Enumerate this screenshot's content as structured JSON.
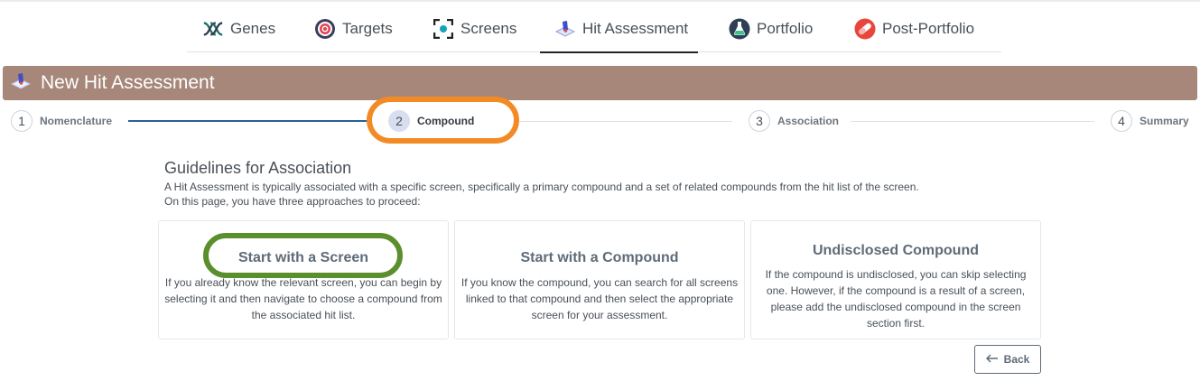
{
  "nav": {
    "items": [
      {
        "label": "Genes",
        "icon": "dna-icon"
      },
      {
        "label": "Targets",
        "icon": "target-icon"
      },
      {
        "label": "Screens",
        "icon": "screen-icon"
      },
      {
        "label": "Hit Assessment",
        "icon": "hit-assessment-icon",
        "active": true
      },
      {
        "label": "Portfolio",
        "icon": "flask-icon"
      },
      {
        "label": "Post-Portfolio",
        "icon": "pill-icon"
      }
    ]
  },
  "banner": {
    "title": "New Hit Assessment",
    "color": "#a68779"
  },
  "stepper": {
    "steps": [
      {
        "number": "1",
        "label": "Nomenclature"
      },
      {
        "number": "2",
        "label": "Compound",
        "current": true
      },
      {
        "number": "3",
        "label": "Association"
      },
      {
        "number": "4",
        "label": "Summary"
      }
    ]
  },
  "guidelines": {
    "title": "Guidelines for Association",
    "line1": "A Hit Assessment is typically associated with a specific screen, specifically a primary compound and a set of related compounds from the hit list of the screen.",
    "line2": "On this page, you have three approaches to proceed:"
  },
  "options": [
    {
      "title": "Start with a Screen",
      "description": "If you already know the relevant screen, you can begin by selecting it and then navigate to choose a compound from the associated hit list."
    },
    {
      "title": "Start with a Compound",
      "description": "If you know the compound, you can search for all screens linked to that compound and then select the appropriate screen for your assessment."
    },
    {
      "title": "Undisclosed Compound",
      "description": "If the compound is undisclosed, you can skip selecting one. However, if the compound is a result of a screen, please add the undisclosed compound in the screen section first."
    }
  ],
  "actions": {
    "back_label": "Back"
  },
  "colors": {
    "highlight_orange": "#f28b25",
    "highlight_green": "#5b8f2e",
    "step_line_done": "#2b5f9e"
  }
}
